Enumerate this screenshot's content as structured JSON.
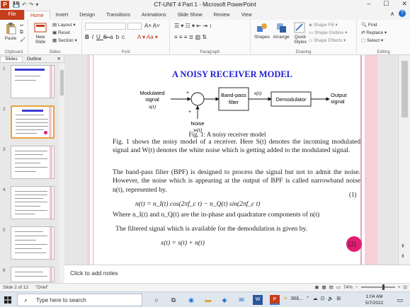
{
  "window": {
    "title": "CT-UNIT 4 Part 1  -  Microsoft PowerPoint",
    "minimize": "–",
    "restore": "☐",
    "close": "✕"
  },
  "tabs": [
    "File",
    "Home",
    "Insert",
    "Design",
    "Transitions",
    "Animations",
    "Slide Show",
    "Review",
    "View"
  ],
  "ribbon": {
    "clipboard": {
      "paste": "Paste",
      "label": "Clipboard"
    },
    "slides": {
      "new_slide": "New Slide",
      "layout": "Layout",
      "reset": "Reset",
      "section": "Section",
      "label": "Slides"
    },
    "font": {
      "bold": "B",
      "italic": "I",
      "underline": "U",
      "strike": "S",
      "abc": "abc",
      "label": "Font"
    },
    "paragraph": {
      "label": "Paragraph"
    },
    "drawing": {
      "shapes": "Shapes",
      "arrange": "Arrange",
      "quick_styles": "Quick Styles",
      "shape_fill": "Shape Fill",
      "shape_outline": "Shape Outline",
      "shape_effects": "Shape Effects",
      "label": "Drawing"
    },
    "editing": {
      "find": "Find",
      "replace": "Replace",
      "select": "Select",
      "label": "Editing"
    }
  },
  "panel": {
    "tab_slides": "Slides",
    "tab_outline": "Outline",
    "close": "✕",
    "thumbnails": [
      "1",
      "2",
      "3",
      "4",
      "5",
      "6"
    ],
    "selected": "2"
  },
  "slide": {
    "title": "A NOISY RECEIVER MODEL",
    "diagram": {
      "input_line1": "Modulated",
      "input_line2": "signal",
      "input_var": "s(t)",
      "plus_left": "+",
      "plus_bottom": "+",
      "bpf_line1": "Band-pass",
      "bpf_line2": "filter",
      "x_label": "x(t)",
      "demod": "Demodulator",
      "output_line1": "Output",
      "output_line2": "signal",
      "noise": "Noise",
      "noise_var": "w(t)"
    },
    "caption": "Fig. 1: A noisy receiver model",
    "para1": "Fig. 1 shows the noisy model of a receiver. Here S(t) denotes the incoming modulated signal and W(t) denotes the white noise which is getting added to the modulated signal.",
    "para2": "The band-pass filter (BPF) is designed to process the signal but not to admit the noise. However, the noise which is appearing at the output of BPF is called narrowband noise n(t), represented by.",
    "eq1_num": "(1)",
    "eq1": "n(t) = n_I(t) cos(2πf_c t) − n_Q(t) sin(2πf_c t)",
    "where_line": "Where n_I(t) and n_Q(t) are the in-phase and quadrature components of n(t)",
    "para3": "The filtered signal which is available for the demodulation is given by.",
    "eq2": "x(t) = s(t) + n(t)",
    "eq2_num": "(2)"
  },
  "notes_placeholder": "Click to add notes",
  "status": {
    "slide_of": "Slide 2 of 12",
    "theme": "\"Oriel\"",
    "zoom": "74%"
  },
  "taskbar": {
    "search_placeholder": "Type here to search",
    "temp": "38â...",
    "time": "1:04 AM",
    "date": "5/7/2022"
  },
  "colors": {
    "accent": "#c43e1c",
    "title_blue": "#2020d0",
    "pink_stripe": "#f4c7cf",
    "magenta_dot": "#e11d74"
  }
}
